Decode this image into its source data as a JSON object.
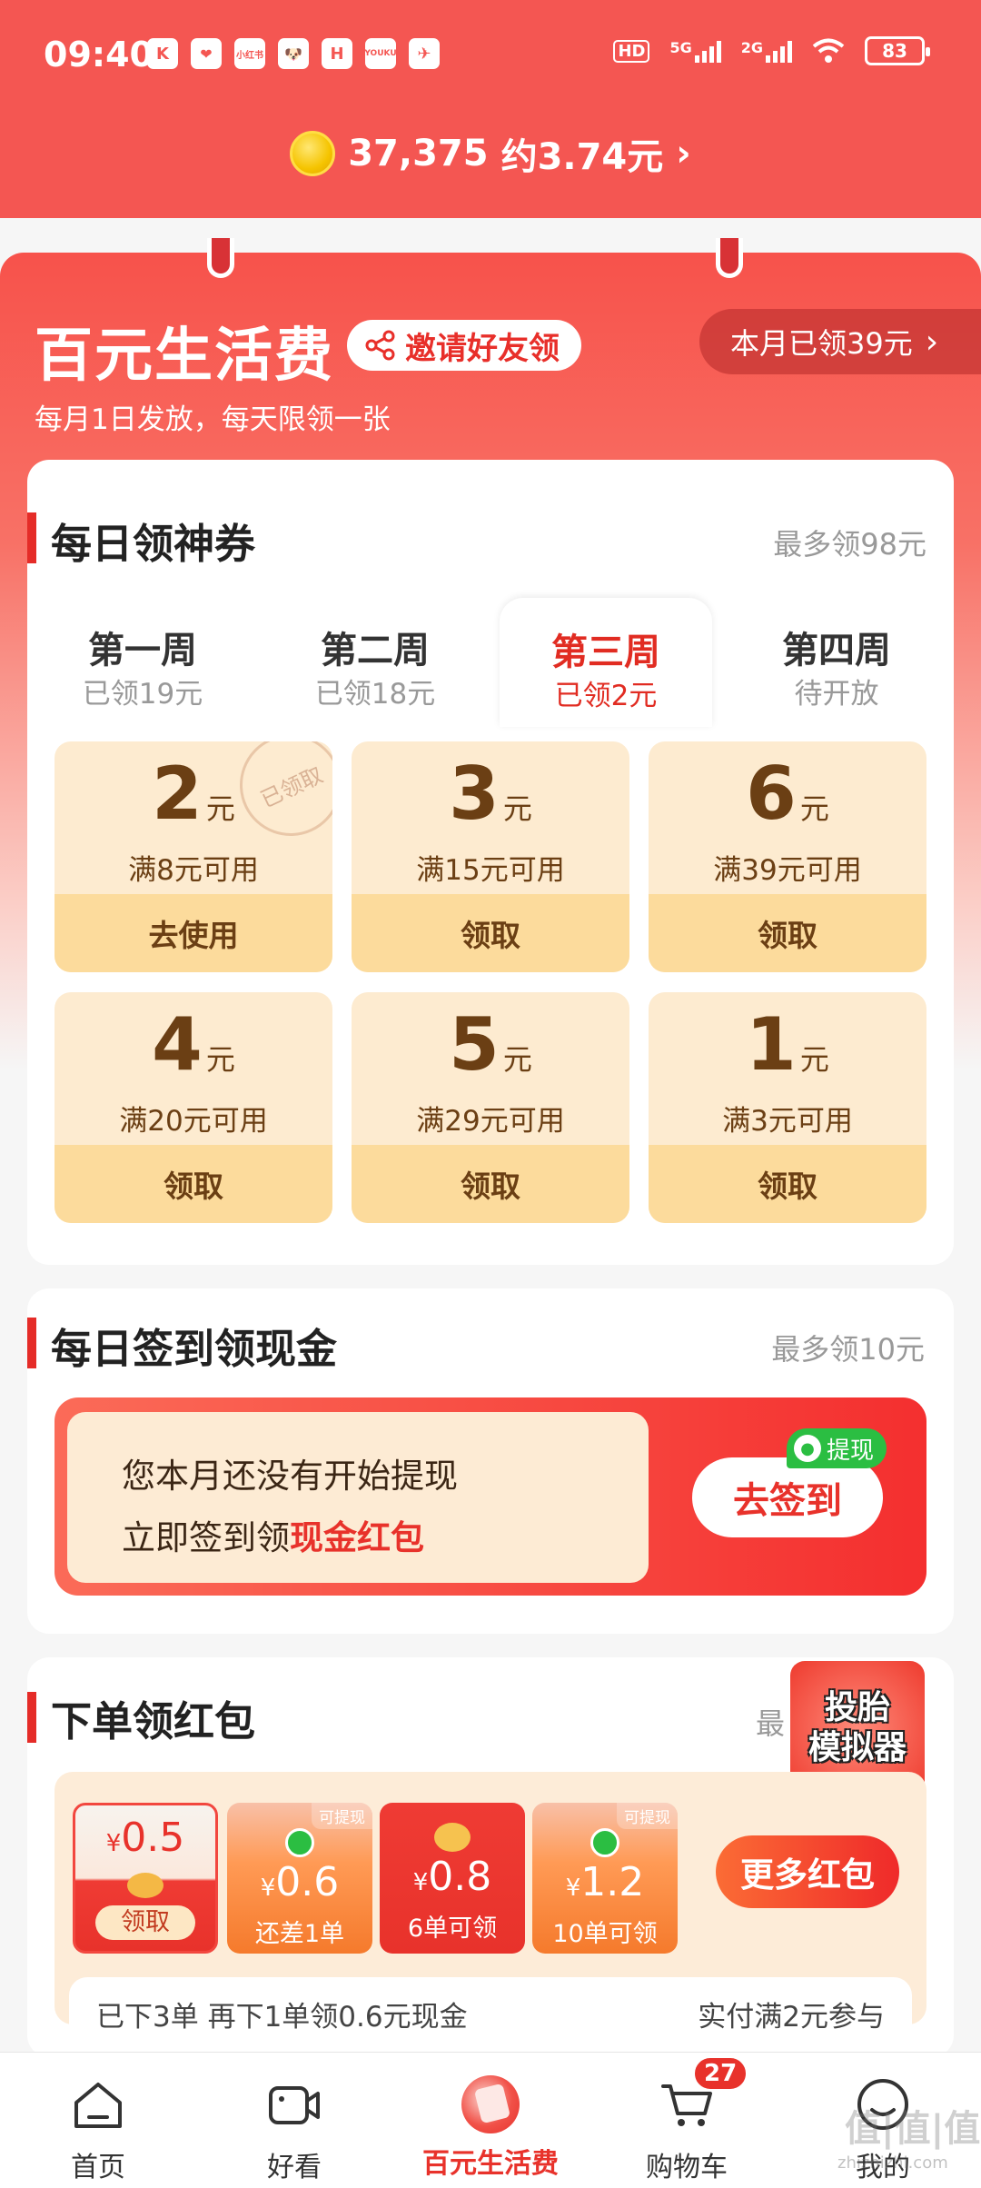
{
  "status_bar": {
    "time": "09:40",
    "apps": [
      "K",
      "❤",
      "小红书",
      "🐶",
      "H",
      "YOUKU",
      "✈"
    ],
    "hd": "HD",
    "net1": "5G",
    "net2": "2G",
    "battery": "83"
  },
  "header": {
    "coins": "37,375",
    "approx": "约3.74元",
    "chevron": "›"
  },
  "banner": {
    "title": "百元生活费",
    "invite_label": "邀请好友领",
    "month_received": "本月已领39元",
    "subtitle": "每月1日发放，每天限领一张"
  },
  "daily_coupons": {
    "title": "每日领神券",
    "max": "最多领98元",
    "weeks": [
      {
        "name": "第一周",
        "status": "已领19元"
      },
      {
        "name": "第二周",
        "status": "已领18元"
      },
      {
        "name": "第三周",
        "status": "已领2元"
      },
      {
        "name": "第四周",
        "status": "待开放"
      }
    ],
    "active_week": 2,
    "coupons": [
      {
        "amount": "2",
        "unit": "元",
        "condition": "满8元可用",
        "action": "去使用",
        "stamp": "已领取"
      },
      {
        "amount": "3",
        "unit": "元",
        "condition": "满15元可用",
        "action": "领取"
      },
      {
        "amount": "6",
        "unit": "元",
        "condition": "满39元可用",
        "action": "领取"
      },
      {
        "amount": "4",
        "unit": "元",
        "condition": "满20元可用",
        "action": "领取"
      },
      {
        "amount": "5",
        "unit": "元",
        "condition": "满29元可用",
        "action": "领取"
      },
      {
        "amount": "1",
        "unit": "元",
        "condition": "满3元可用",
        "action": "领取"
      }
    ]
  },
  "sign_in": {
    "title": "每日签到领现金",
    "max": "最多领10元",
    "line1": "您本月还没有开始提现",
    "line2_prefix": "立即签到领",
    "line2_highlight": "现金红包",
    "button": "去签到",
    "withdraw_badge": "提现"
  },
  "order_packets": {
    "title": "下单领红包",
    "max_partial": "最",
    "game_line1": "投胎",
    "game_line2": "模拟器",
    "packets": [
      {
        "amount": "0.5",
        "label": "领取",
        "tag": ""
      },
      {
        "amount": "0.6",
        "label": "还差1单",
        "tag": "可提现"
      },
      {
        "amount": "0.8",
        "label": "6单可领",
        "tag": ""
      },
      {
        "amount": "1.2",
        "label": "10单可领",
        "tag": "可提现"
      }
    ],
    "currency": "¥",
    "more_button": "更多红包",
    "ticket_left": "已下3单    再下1单领0.6元现金",
    "ticket_right": "实付满2元参与"
  },
  "nav": {
    "items": [
      "首页",
      "好看",
      "百元生活费",
      "购物车",
      "我的"
    ],
    "active": 2,
    "cart_badge": "27"
  },
  "watermark": {
    "text": "值|值|值",
    "url": "zhizhizhi.com"
  }
}
